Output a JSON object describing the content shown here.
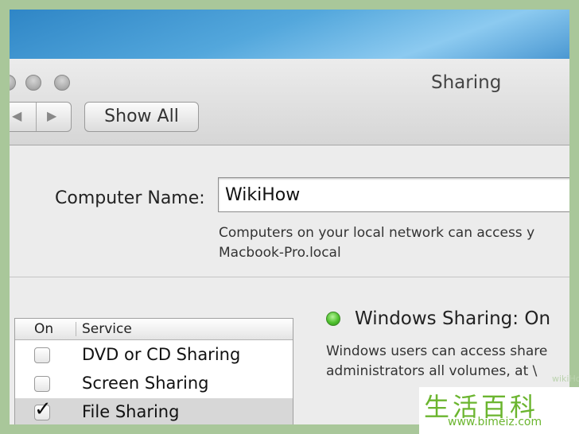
{
  "window": {
    "title": "Sharing",
    "traffic_lights": [
      "close",
      "minimize",
      "zoom"
    ]
  },
  "toolbar": {
    "back_icon": "◀",
    "forward_icon": "▶",
    "show_all_label": "Show All"
  },
  "computer_name": {
    "label": "Computer Name:",
    "value": "WikiHow",
    "description": "Computers on your local network can access y\nMacbook-Pro.local"
  },
  "services": {
    "headers": {
      "on": "On",
      "service": "Service"
    },
    "items": [
      {
        "label": "DVD or CD Sharing",
        "checked": false,
        "selected": false
      },
      {
        "label": "Screen Sharing",
        "checked": false,
        "selected": false
      },
      {
        "label": "File Sharing",
        "checked": true,
        "selected": true
      }
    ]
  },
  "status": {
    "indicator_color": "#4fc12e",
    "title": "Windows Sharing: On",
    "description": "Windows users can access share\nadministrators all volumes, at \\"
  },
  "watermark": {
    "chars": "生活百科",
    "url": "www.bimeiz.com",
    "side_text": "wikiHow"
  }
}
